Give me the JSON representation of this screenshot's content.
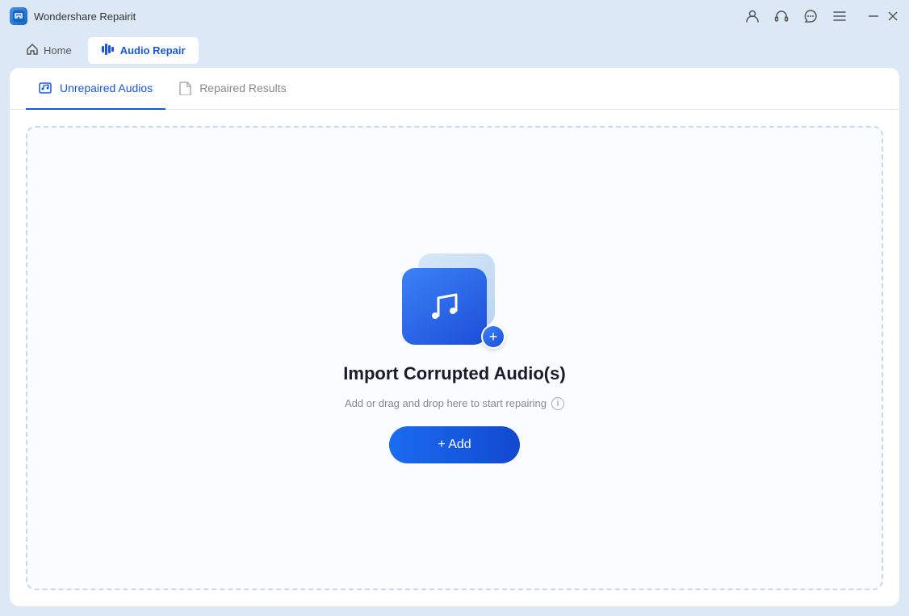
{
  "titlebar": {
    "app_name": "Wondershare Repairit",
    "icons": {
      "user": "👤",
      "headset": "🎧",
      "chat": "💬",
      "menu": "≡",
      "minimize": "—",
      "close": "✕"
    }
  },
  "navbar": {
    "home_label": "Home",
    "audio_repair_label": "Audio Repair"
  },
  "tabs": {
    "tab1_label": "Unrepaired Audios",
    "tab2_label": "Repaired Results"
  },
  "dropzone": {
    "title": "Import Corrupted Audio(s)",
    "subtitle": "Add or drag and drop here to start repairing",
    "add_button_label": "+ Add"
  }
}
